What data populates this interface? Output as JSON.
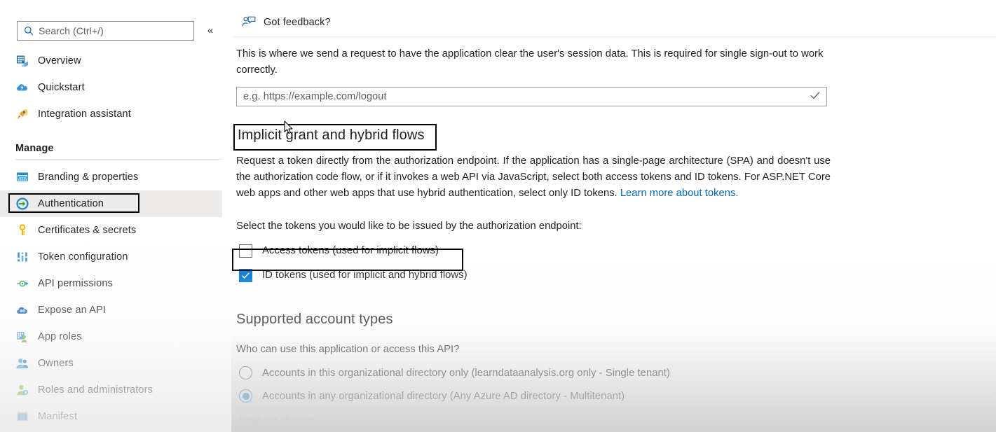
{
  "sidebar": {
    "search": {
      "placeholder": "Search (Ctrl+/)",
      "icon": "search-icon"
    },
    "collapse_label": "«",
    "top_items": [
      {
        "label": "Overview",
        "icon": "overview-grid-icon"
      },
      {
        "label": "Quickstart",
        "icon": "quickstart-cloud-icon"
      },
      {
        "label": "Integration assistant",
        "icon": "rocket-icon"
      }
    ],
    "group_title": "Manage",
    "manage_items": [
      {
        "label": "Branding & properties",
        "icon": "branding-window-icon",
        "selected": false
      },
      {
        "label": "Authentication",
        "icon": "authentication-arrow-icon",
        "selected": true
      },
      {
        "label": "Certificates & secrets",
        "icon": "key-icon",
        "selected": false
      },
      {
        "label": "Token configuration",
        "icon": "token-sliders-icon",
        "selected": false
      },
      {
        "label": "API permissions",
        "icon": "api-permissions-icon",
        "selected": false
      },
      {
        "label": "Expose an API",
        "icon": "expose-api-cloud-icon",
        "selected": false
      },
      {
        "label": "App roles",
        "icon": "app-roles-icon",
        "selected": false
      },
      {
        "label": "Owners",
        "icon": "owners-people-icon",
        "selected": false
      },
      {
        "label": "Roles and administrators",
        "icon": "roles-admin-icon",
        "selected": false
      },
      {
        "label": "Manifest",
        "icon": "manifest-braces-icon",
        "selected": false
      }
    ]
  },
  "main": {
    "feedback": {
      "label": "Got feedback?",
      "icon": "feedback-person-icon"
    },
    "front_channel_logout": {
      "description": "This is where we send a request to have the application clear the user's session data. This is required for single sign-out to work correctly.",
      "input_placeholder": "e.g. https://example.com/logout",
      "input_value": "",
      "validation_icon": "checkmark-icon"
    },
    "implicit": {
      "heading": "Implicit grant and hybrid flows",
      "description_part1": "Request a token directly from the authorization endpoint. If the application has a single-page architecture (SPA) and doesn't use the authorization code flow, or if it invokes a web API via JavaScript, select both access tokens and ID tokens. For ASP.NET Core web apps and other web apps that use hybrid authentication, select only ID tokens. ",
      "link_text": "Learn more about tokens.",
      "select_prompt": "Select the tokens you would like to be issued by the authorization endpoint:",
      "checkboxes": [
        {
          "label": "Access tokens (used for implicit flows)",
          "checked": false
        },
        {
          "label": "ID tokens (used for implicit and hybrid flows)",
          "checked": true
        }
      ]
    },
    "supported_account_types": {
      "heading": "Supported account types",
      "prompt": "Who can use this application or access this API?",
      "options": [
        {
          "label": "Accounts in this organizational directory only (learndataanalysis.org only - Single tenant)",
          "selected": false
        },
        {
          "label": "Accounts in any organizational directory (Any Azure AD directory - Multitenant)",
          "selected": true
        }
      ],
      "help_link": "Help me choose..."
    }
  },
  "annotations": {
    "highlight_color": "#000000",
    "targets": [
      "sidebar-item-authentication",
      "implicit-grant-heading",
      "access-tokens-checkbox-row"
    ]
  },
  "colors": {
    "accent": "#0078d4",
    "link": "#0067b8",
    "selected_row": "#edebe9",
    "text": "#201f1e",
    "muted_text": "#605e5c"
  }
}
